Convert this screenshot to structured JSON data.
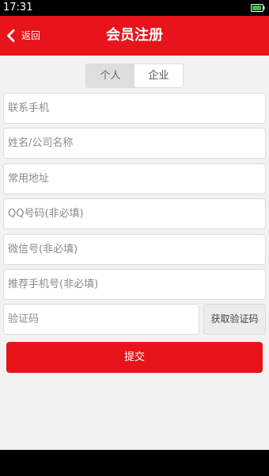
{
  "status_bar": {
    "time": "17:31",
    "battery": {
      "icon": "battery-icon",
      "level": 0.9,
      "color": "#3cbf3c"
    }
  },
  "header": {
    "back_icon": "chevron-left-icon",
    "back_label": "返回",
    "title": "会员注册",
    "background": "#e8141c"
  },
  "tabs": [
    {
      "label": "个人",
      "selected": true
    },
    {
      "label": "企业",
      "selected": false
    }
  ],
  "form": {
    "fields": [
      {
        "placeholder": "联系手机",
        "value": ""
      },
      {
        "placeholder": "姓名/公司名称",
        "value": ""
      },
      {
        "placeholder": "常用地址",
        "value": ""
      },
      {
        "placeholder": "QQ号码(非必填)",
        "value": ""
      },
      {
        "placeholder": "微信号(非必填)",
        "value": ""
      },
      {
        "placeholder": "推荐手机号(非必填)",
        "value": ""
      }
    ],
    "verification": {
      "placeholder": "验证码",
      "value": "",
      "button_label": "获取验证码"
    },
    "submit_label": "提交"
  },
  "colors": {
    "accent": "#e8141c",
    "background": "#f2f2f2",
    "tab_active": "#dedede",
    "placeholder": "#8a8a8a"
  }
}
